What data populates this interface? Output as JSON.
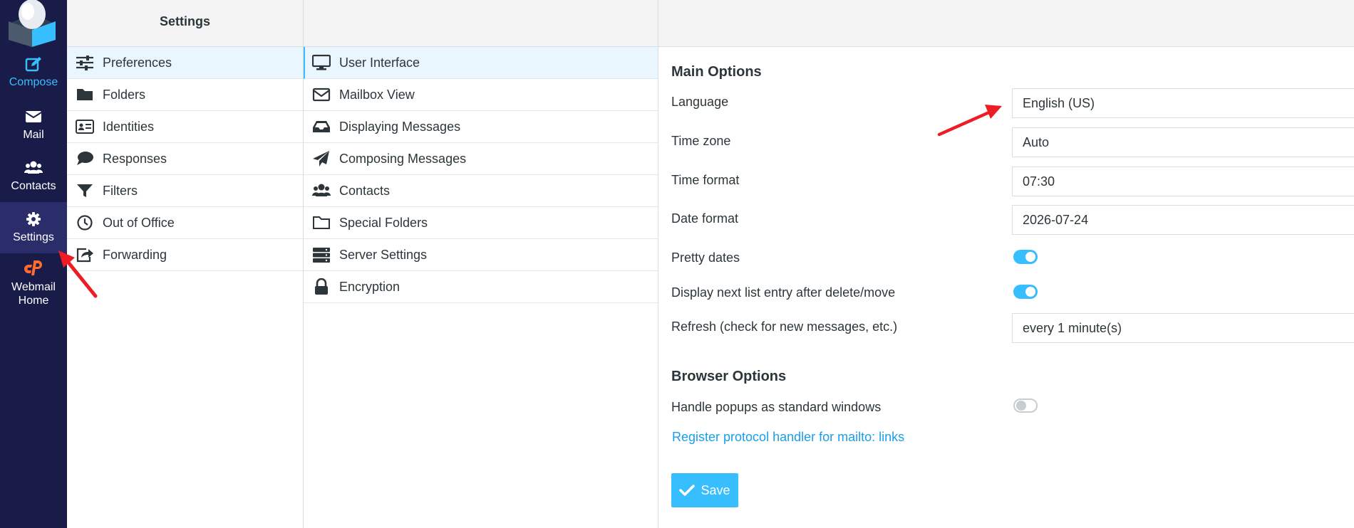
{
  "rail": {
    "compose": "Compose",
    "mail": "Mail",
    "contacts": "Contacts",
    "settings": "Settings",
    "webmail_home": "Webmail Home"
  },
  "settings_column": {
    "title": "Settings",
    "items": [
      {
        "label": "Preferences",
        "icon": "sliders-icon",
        "selected": true
      },
      {
        "label": "Folders",
        "icon": "folder-icon"
      },
      {
        "label": "Identities",
        "icon": "id-card-icon"
      },
      {
        "label": "Responses",
        "icon": "comment-icon"
      },
      {
        "label": "Filters",
        "icon": "filter-icon"
      },
      {
        "label": "Out of Office",
        "icon": "clock-icon"
      },
      {
        "label": "Forwarding",
        "icon": "share-icon"
      }
    ]
  },
  "preferences_column": {
    "items": [
      {
        "label": "User Interface",
        "icon": "desktop-icon",
        "selected": true
      },
      {
        "label": "Mailbox View",
        "icon": "envelope-icon"
      },
      {
        "label": "Displaying Messages",
        "icon": "inbox-icon"
      },
      {
        "label": "Composing Messages",
        "icon": "paper-plane-icon"
      },
      {
        "label": "Contacts",
        "icon": "users-icon"
      },
      {
        "label": "Special Folders",
        "icon": "folder-open-icon"
      },
      {
        "label": "Server Settings",
        "icon": "server-icon"
      },
      {
        "label": "Encryption",
        "icon": "lock-icon"
      }
    ]
  },
  "form": {
    "main_options_title": "Main Options",
    "language_label": "Language",
    "language_value": "English (US)",
    "timezone_label": "Time zone",
    "timezone_value": "Auto",
    "timeformat_label": "Time format",
    "timeformat_value": "07:30",
    "dateformat_label": "Date format",
    "dateformat_value": "2026-07-24",
    "pretty_dates_label": "Pretty dates",
    "pretty_dates_on": true,
    "display_next_label": "Display next list entry after delete/move",
    "display_next_on": true,
    "refresh_label": "Refresh (check for new messages, etc.)",
    "refresh_value": "every 1 minute(s)",
    "browser_options_title": "Browser Options",
    "popups_label": "Handle popups as standard windows",
    "popups_on": false,
    "register_link": "Register protocol handler for mailto: links",
    "save_label": "Save"
  },
  "colors": {
    "rail_bg": "#191b49",
    "accent": "#37beff",
    "link": "#1a9ee8",
    "annotation_arrow": "#ee1c24"
  }
}
